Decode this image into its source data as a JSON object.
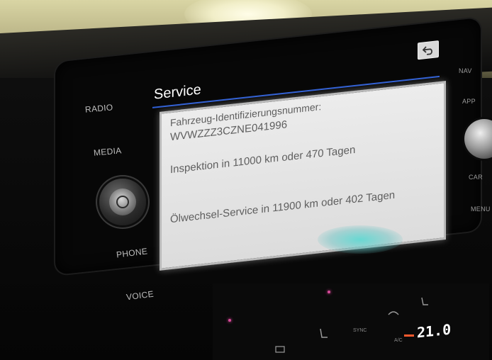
{
  "infotainment": {
    "left_buttons": {
      "radio": "RADIO",
      "media": "MEDIA",
      "phone": "PHONE",
      "voice": "VOICE"
    },
    "right_buttons": {
      "nav": "NAV",
      "app": "APP",
      "car": "CAR",
      "menu": "MENU"
    },
    "screen": {
      "title": "Service",
      "back_icon": "back-arrow-icon",
      "accent_color": "#2f5fd6",
      "popup": {
        "vin_label": "Fahrzeug-Identifizierungsnummer:",
        "vin": "WVWZZZ3CZNE041996",
        "inspection": "Inspektion in 11000 km oder 470 Tagen",
        "oil_service": "Ölwechsel-Service in 11900 km oder 402 Tagen"
      }
    }
  },
  "climate": {
    "sync_label": "SYNC",
    "ac_label": "A/C",
    "temperature": "21.0",
    "temp_color": "#ff5a2e"
  }
}
